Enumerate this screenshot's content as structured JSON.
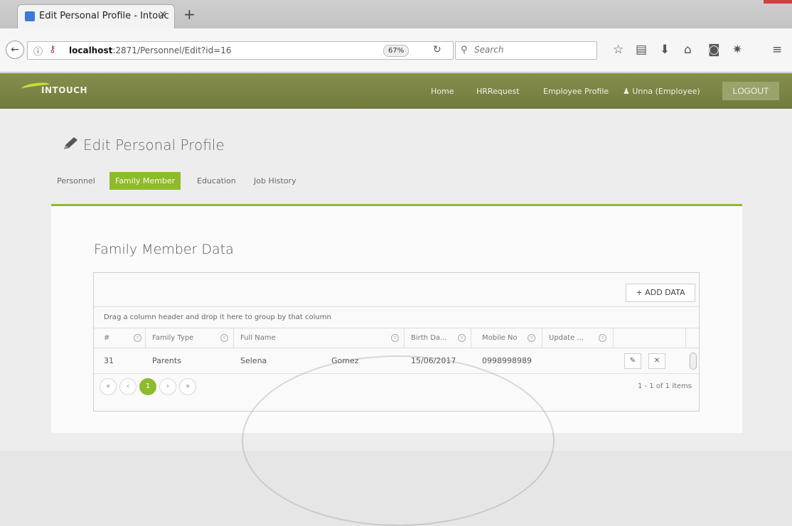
{
  "browser": {
    "tab_title": "Edit Personal Profile - Intouc",
    "tab_close": "✕",
    "new_tab": "+",
    "url_host": "localhost",
    "url_path": ":2871/Personnel/Edit?id=16",
    "zoom": "67%",
    "search_placeholder": "Search"
  },
  "app": {
    "logo": "INTOUCH",
    "nav": [
      "Home",
      "HRRequest",
      "Employee Profile",
      "Unna (Employee)"
    ],
    "logout": "LOGOUT"
  },
  "page": {
    "title": "Edit Personal Profile",
    "tabs": [
      "Personnel",
      "Family Member",
      "Education",
      "Job History"
    ],
    "active_tab": "Family Member",
    "accent": "#8dbb2c"
  },
  "card": {
    "title": "Family Member Data",
    "add_button": "+ ADD DATA",
    "group_hint": "Drag a column header and drop it here to group by that column",
    "columns": [
      "#",
      "Family Type",
      "Full Name",
      "Birth Da...",
      "Mobile No",
      "Update ..."
    ],
    "row": {
      "id": "31",
      "family_type": "Parents",
      "first_name": "Selena",
      "last_name": "Gomez",
      "birth_date": "15/06/2017",
      "mobile": "0998998989",
      "edit_icon": "✎",
      "delete_icon": "✕"
    },
    "pager": {
      "first": "«",
      "prev": "‹",
      "current_page": "1",
      "next": "›",
      "last": "»",
      "info": "1 - 1 of 1 items"
    }
  }
}
